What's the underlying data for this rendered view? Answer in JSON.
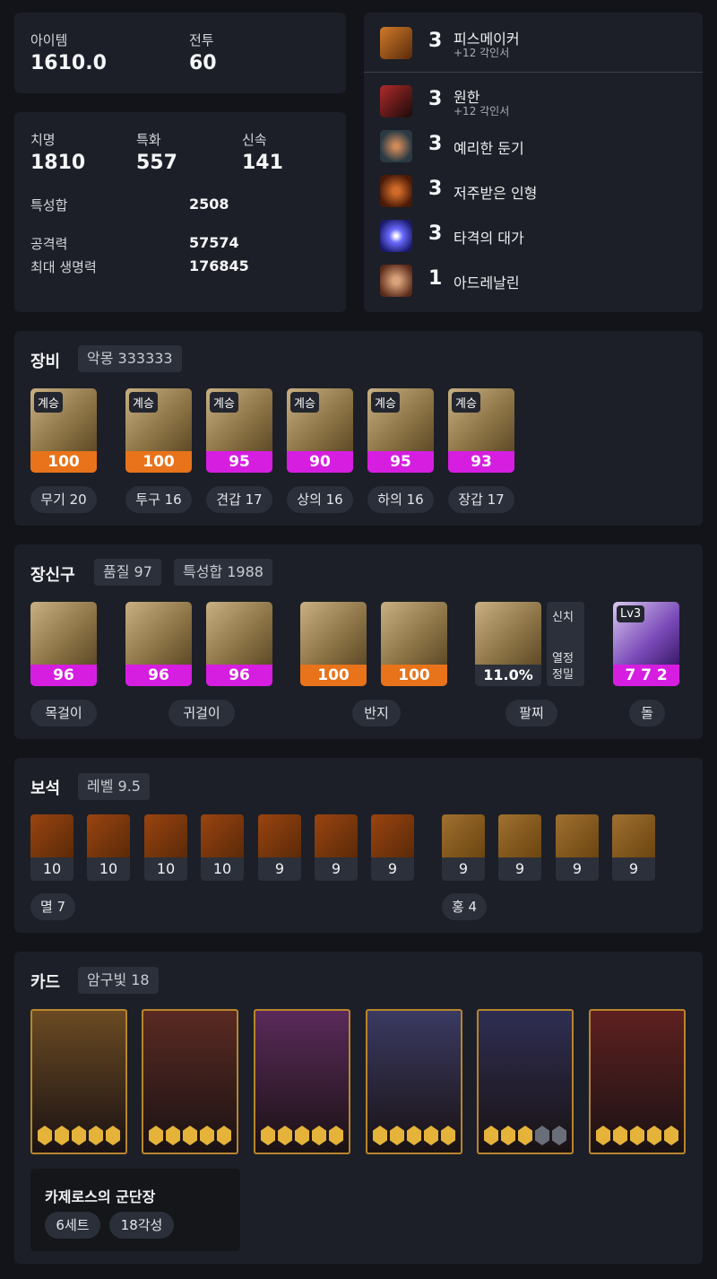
{
  "summary": {
    "item_label": "아이템",
    "item_value": "1610.0",
    "combat_label": "전투",
    "combat_value": "60"
  },
  "stats": {
    "crit_label": "치명",
    "crit_value": "1810",
    "spec_label": "특화",
    "spec_value": "557",
    "swift_label": "신속",
    "swift_value": "141",
    "total_label": "특성합",
    "total_value": "2508",
    "atk_label": "공격력",
    "atk_value": "57574",
    "hp_label": "최대 생명력",
    "hp_value": "176845"
  },
  "engravings": [
    {
      "level": "3",
      "name": "피스메이커",
      "sub": "+12 각인서",
      "icon": "pistol-icon",
      "color": "#a0521c"
    },
    {
      "level": "3",
      "name": "원한",
      "sub": "+12 각인서",
      "icon": "demon-icon",
      "color": "#7a1d22"
    },
    {
      "level": "3",
      "name": "예리한 둔기",
      "sub": "",
      "icon": "mace-icon",
      "color": "#3a4e5a"
    },
    {
      "level": "3",
      "name": "저주받은 인형",
      "sub": "",
      "icon": "doll-icon",
      "color": "#8a3a12"
    },
    {
      "level": "3",
      "name": "타격의 대가",
      "sub": "",
      "icon": "lightning-icon",
      "color": "#3d3fb8"
    },
    {
      "level": "1",
      "name": "아드레날린",
      "sub": "",
      "icon": "adrenaline-icon",
      "color": "#8a4a2a"
    }
  ],
  "equipment": {
    "title": "장비",
    "set_chip": "악몽 333333",
    "badge": "계승",
    "items": [
      {
        "quality": "100",
        "label": "무기 20",
        "bar": "orange",
        "icon": "weapon-icon"
      },
      {
        "quality": "100",
        "label": "투구 16",
        "bar": "orange",
        "icon": "helmet-icon"
      },
      {
        "quality": "95",
        "label": "견갑 17",
        "bar": "magenta",
        "icon": "shoulder-icon"
      },
      {
        "quality": "90",
        "label": "상의 16",
        "bar": "magenta",
        "icon": "chest-icon"
      },
      {
        "quality": "95",
        "label": "하의 16",
        "bar": "magenta",
        "icon": "pants-icon"
      },
      {
        "quality": "93",
        "label": "장갑 17",
        "bar": "magenta",
        "icon": "gloves-icon"
      }
    ]
  },
  "accessories": {
    "title": "장신구",
    "quality_chip": "품질 97",
    "stat_chip": "특성합 1988",
    "items": [
      {
        "quality": "96",
        "bar": "magenta",
        "icon": "necklace-icon"
      },
      {
        "quality": "96",
        "bar": "magenta",
        "icon": "earring-icon"
      },
      {
        "quality": "96",
        "bar": "magenta",
        "icon": "earring-icon"
      },
      {
        "quality": "100",
        "bar": "orange",
        "icon": "ring-icon"
      },
      {
        "quality": "100",
        "bar": "orange",
        "icon": "ring-icon"
      }
    ],
    "labels": {
      "necklace": "목걸이",
      "earring": "귀걸이",
      "ring": "반지",
      "bracelet": "팔찌",
      "stone": "돌"
    },
    "bracelet": {
      "value": "11.0%",
      "effects": [
        "신치",
        "열정",
        "정밀"
      ]
    },
    "stone": {
      "level": "Lv3",
      "value": "7 7 2"
    }
  },
  "gems": {
    "title": "보석",
    "level_chip": "레벨 9.5",
    "annihilation": [
      "10",
      "10",
      "10",
      "10",
      "9",
      "9",
      "9"
    ],
    "crimson": [
      "9",
      "9",
      "9",
      "9"
    ],
    "annihilation_label": "멸 7",
    "crimson_label": "홍 4"
  },
  "cards": {
    "title": "카드",
    "awaken_chip": "암구빛 18",
    "set_name": "카제로스의 군단장",
    "set_count": "6세트",
    "awaken": "18각성",
    "items": [
      {
        "awaken": 5,
        "art": "#6a4a22"
      },
      {
        "awaken": 5,
        "art": "#5a2a22"
      },
      {
        "awaken": 5,
        "art": "#5a2a5a"
      },
      {
        "awaken": 5,
        "art": "#3a3a62"
      },
      {
        "awaken": 3,
        "art": "#2e2e52"
      },
      {
        "awaken": 5,
        "art": "#5e2020"
      }
    ]
  }
}
